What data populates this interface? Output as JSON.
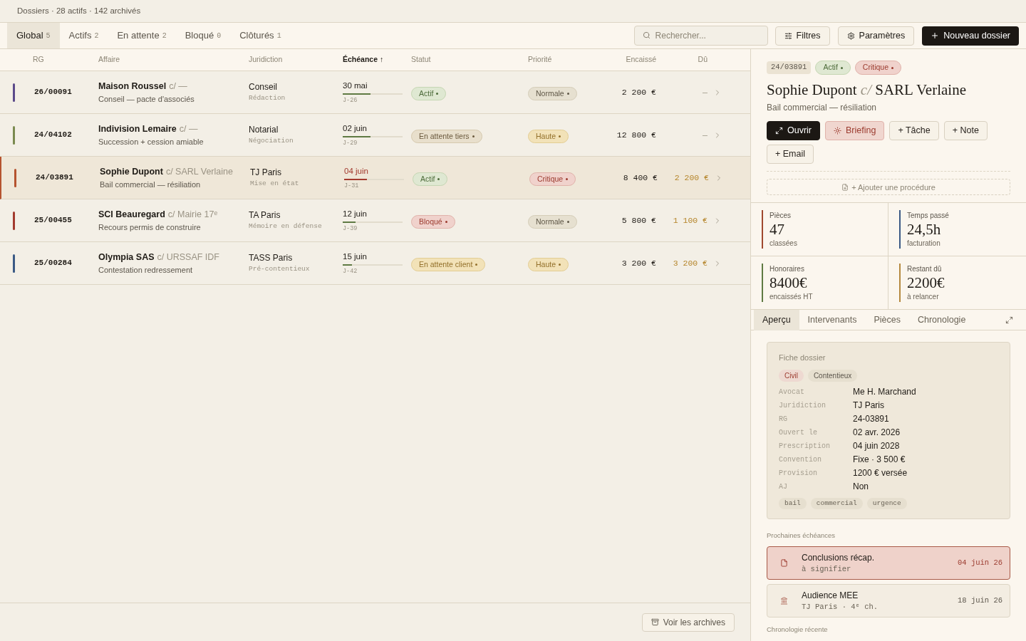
{
  "header": {
    "title": "Dossiers · 28 actifs · 142 archivés"
  },
  "tabs": [
    {
      "label": "Global",
      "count": "5",
      "selected": true
    },
    {
      "label": "Actifs",
      "count": "2",
      "selected": false
    },
    {
      "label": "En attente",
      "count": "2",
      "selected": false
    },
    {
      "label": "Bloqué",
      "count": "0",
      "selected": false
    },
    {
      "label": "Clôturés",
      "count": "1",
      "selected": false
    }
  ],
  "search": {
    "placeholder": "Rechercher..."
  },
  "toolbar": {
    "filters": "Filtres",
    "settings": "Paramètres",
    "new": "Nouveau dossier"
  },
  "table": {
    "columns": [
      {
        "label": "RG",
        "sorted": false
      },
      {
        "label": "Affaire",
        "sorted": false
      },
      {
        "label": "Juridiction",
        "sorted": false
      },
      {
        "label": "Échéance",
        "sorted": true,
        "arrow": "↑"
      },
      {
        "label": "Statut",
        "sorted": false
      },
      {
        "label": "Priorité",
        "sorted": false
      },
      {
        "label": "Encaissé",
        "sorted": false
      },
      {
        "label": "Dû",
        "sorted": false
      }
    ],
    "rows": [
      {
        "color": "#5b4a8a",
        "rg": "26/00091",
        "party": "Maison Roussel",
        "opponent": "c/ —",
        "subject": "Conseil — pacte d'associés",
        "court": "Conseil",
        "stage": "Rédaction",
        "due_date": "30 mai",
        "level": 0.47,
        "urgent": false,
        "countdown": "J-26",
        "status": {
          "label": "Actif",
          "kind": "active"
        },
        "priority": {
          "label": "Normale",
          "kind": "normal"
        },
        "paid": "2 200 €",
        "owed": {
          "text": "—",
          "outstanding": false
        },
        "selected": false
      },
      {
        "color": "#7a8a4f",
        "rg": "24/04102",
        "party": "Indivision Lemaire",
        "opponent": "c/ —",
        "subject": "Succession + cession amiable",
        "court": "Notarial",
        "stage": "Négociation",
        "due_date": "02 juin",
        "level": 0.46,
        "urgent": false,
        "countdown": "J-29",
        "status": {
          "label": "En attente tiers",
          "kind": "waiting_third"
        },
        "priority": {
          "label": "Haute",
          "kind": "high"
        },
        "paid": "12 800 €",
        "owed": {
          "text": "—",
          "outstanding": false
        },
        "selected": false
      },
      {
        "color": "#b5532f",
        "rg": "24/03891",
        "party": "Sophie Dupont",
        "opponent": "c/ SARL Verlaine",
        "subject": "Bail commercial — résiliation",
        "court": "TJ Paris",
        "stage": "Mise en état",
        "due_date": "04 juin",
        "level": 0.38,
        "urgent": true,
        "countdown": "J-31",
        "status": {
          "label": "Actif",
          "kind": "active"
        },
        "priority": {
          "label": "Critique",
          "kind": "critical"
        },
        "paid": "8 400 €",
        "owed": {
          "text": "2 200 €",
          "outstanding": true
        },
        "selected": true
      },
      {
        "color": "#a23a2e",
        "rg": "25/00455",
        "party": "SCI Beauregard",
        "opponent": "c/ Mairie 17ᵉ",
        "subject": "Recours permis de construire",
        "court": "TA Paris",
        "stage": "Mémoire en défense",
        "due_date": "12 juin",
        "level": 0.21,
        "urgent": false,
        "countdown": "J-39",
        "status": {
          "label": "Bloqué",
          "kind": "blocked"
        },
        "priority": {
          "label": "Normale",
          "kind": "normal"
        },
        "paid": "5 800 €",
        "owed": {
          "text": "1 100 €",
          "outstanding": true
        },
        "selected": false
      },
      {
        "color": "#3b5a85",
        "rg": "25/00284",
        "party": "Olympia SAS",
        "opponent": "c/ URSSAF IDF",
        "subject": "Contestation redressement",
        "court": "TASS Paris",
        "stage": "Pré-contentieux",
        "due_date": "15 juin",
        "level": 0.15,
        "urgent": false,
        "countdown": "J-42",
        "status": {
          "label": "En attente client",
          "kind": "waiting_client"
        },
        "priority": {
          "label": "Haute",
          "kind": "high"
        },
        "paid": "3 200 €",
        "owed": {
          "text": "3 200 €",
          "outstanding": true
        },
        "selected": false
      }
    ]
  },
  "archives_button": "Voir les archives",
  "detail": {
    "rg": "24/03891",
    "status": {
      "label": "Actif",
      "kind": "active"
    },
    "priority": {
      "label": "Critique",
      "kind": "critical"
    },
    "party": "Sophie Dupont",
    "versus": "c/",
    "opponent": "SARL Verlaine",
    "subject": "Bail commercial — résiliation",
    "actions": [
      {
        "label": "Ouvrir",
        "kind": "primary"
      },
      {
        "label": "Briefing",
        "kind": "accent"
      },
      {
        "label": "+ Tâche",
        "kind": "plain"
      },
      {
        "label": "+ Note",
        "kind": "plain"
      },
      {
        "label": "+ Email",
        "kind": "plain"
      }
    ],
    "add_procedure": "+ Ajouter une procédure",
    "stats": [
      {
        "label": "Pièces",
        "value": "47",
        "note": "classées",
        "color": "#a0492f"
      },
      {
        "label": "Temps passé",
        "value": "24,5h",
        "note": "facturation",
        "color": "#3b5a85"
      },
      {
        "label": "Honoraires",
        "value": "8400€",
        "note": "encaissés HT",
        "color": "#5f7a43"
      },
      {
        "label": "Restant dû",
        "value": "2200€",
        "note": "à relancer",
        "color": "#b5893f"
      }
    ],
    "tabs": [
      {
        "label": "Aperçu",
        "selected": true
      },
      {
        "label": "Intervenants",
        "selected": false
      },
      {
        "label": "Pièces",
        "selected": false
      },
      {
        "label": "Chronologie",
        "selected": false
      }
    ],
    "card": {
      "title": "Fiche dossier",
      "categories": [
        {
          "label": "Civil",
          "kind": "accent"
        },
        {
          "label": "Contentieux",
          "kind": "plain"
        }
      ],
      "fields": [
        {
          "label": "Avocat",
          "value": "Me H. Marchand"
        },
        {
          "label": "Juridiction",
          "value": "TJ Paris"
        },
        {
          "label": "RG",
          "value": "24-03891"
        },
        {
          "label": "Ouvert le",
          "value": "02 avr. 2026"
        },
        {
          "label": "Prescription",
          "value": "04 juin 2028"
        },
        {
          "label": "Convention",
          "value": "Fixe · 3 500 €"
        },
        {
          "label": "Provision",
          "value": "1200 € versée"
        },
        {
          "label": "AJ",
          "value": "Non"
        }
      ],
      "tags": [
        "bail",
        "commercial",
        "urgence"
      ]
    },
    "deadlines_title": "Prochaines échéances",
    "deadlines": [
      {
        "title": "Conclusions récap.",
        "sub": "à signifier",
        "date": "04 juin 26",
        "urgent": true,
        "kind": "document"
      },
      {
        "title": "Audience MEE",
        "sub": "TJ Paris · 4ᵉ ch.",
        "date": "18 juin 26",
        "urgent": false,
        "kind": "hearing"
      }
    ],
    "timeline_title": "Chronologie récente"
  }
}
